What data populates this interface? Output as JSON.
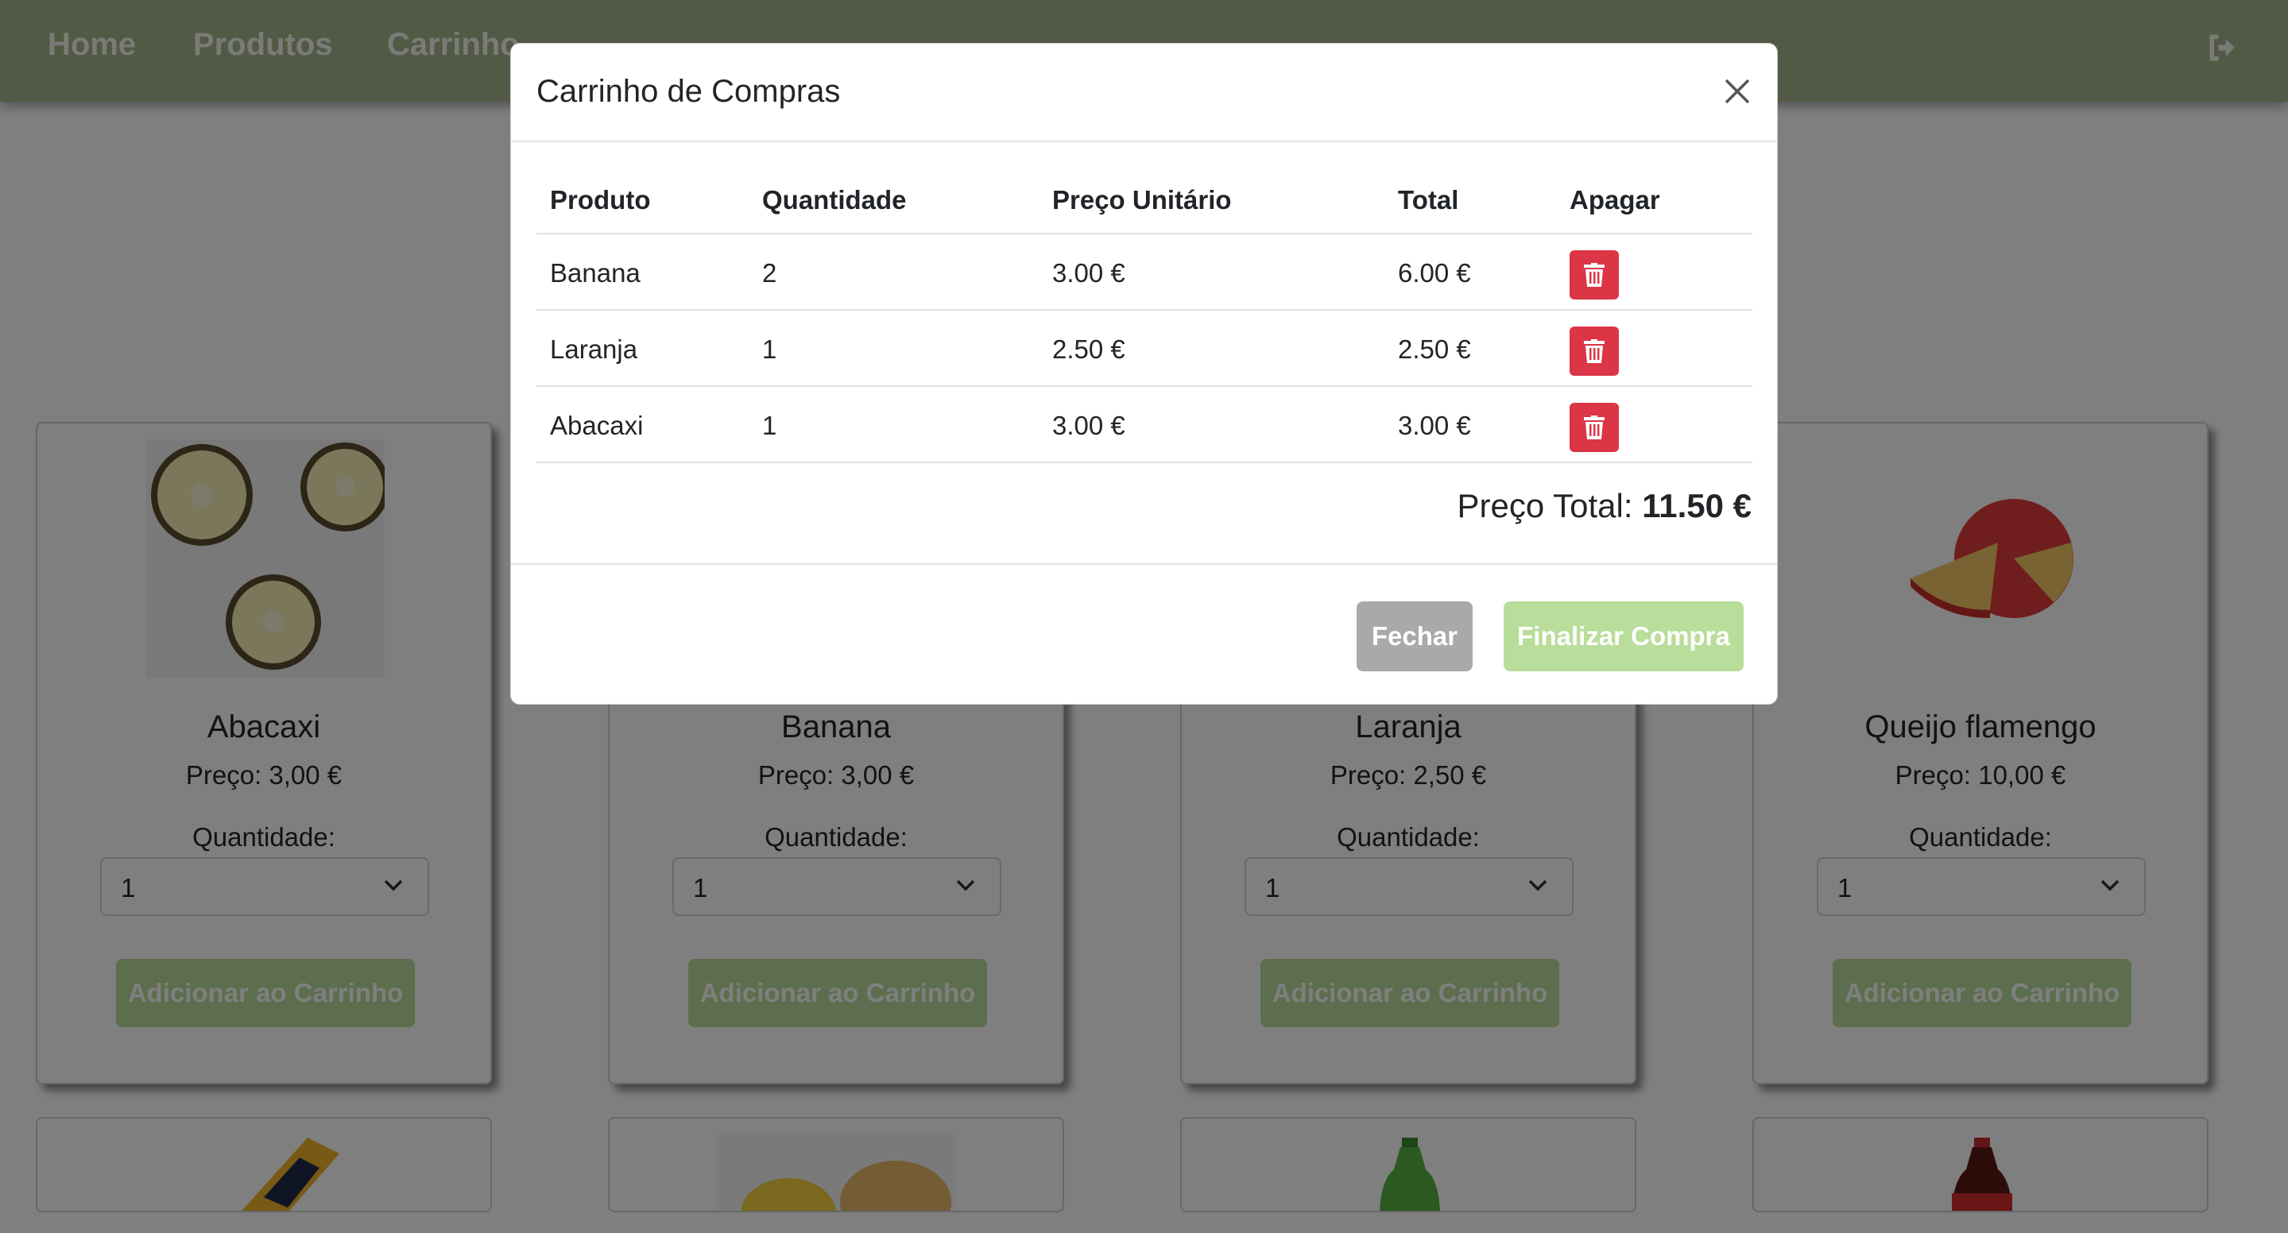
{
  "nav": {
    "home": "Home",
    "produtos": "Produtos",
    "carrinho": "Carrinho"
  },
  "products": [
    {
      "name": "Abacaxi",
      "price": "Preço: 3,00 €",
      "qty_label": "Quantidade:",
      "qty": "1",
      "add_label": "Adicionar ao Carrinho"
    },
    {
      "name": "Banana",
      "price": "Preço: 3,00 €",
      "qty_label": "Quantidade:",
      "qty": "1",
      "add_label": "Adicionar ao Carrinho"
    },
    {
      "name": "Laranja",
      "price": "Preço: 2,50 €",
      "qty_label": "Quantidade:",
      "qty": "1",
      "add_label": "Adicionar ao Carrinho"
    },
    {
      "name": "Queijo flamengo",
      "price": "Preço: 10,00 €",
      "qty_label": "Quantidade:",
      "qty": "1",
      "add_label": "Adicionar ao Carrinho"
    }
  ],
  "modal": {
    "title": "Carrinho de Compras",
    "headers": {
      "produto": "Produto",
      "quantidade": "Quantidade",
      "preco_unitario": "Preço Unitário",
      "total": "Total",
      "apagar": "Apagar"
    },
    "rows": [
      {
        "produto": "Banana",
        "quantidade": "2",
        "preco_unitario": "3.00 €",
        "total": "6.00 €"
      },
      {
        "produto": "Laranja",
        "quantidade": "1",
        "preco_unitario": "2.50 €",
        "total": "2.50 €"
      },
      {
        "produto": "Abacaxi",
        "quantidade": "1",
        "preco_unitario": "3.00 €",
        "total": "3.00 €"
      }
    ],
    "total_label": "Preço Total:",
    "total_value": "11.50 €",
    "close_label": "Fechar",
    "finish_label": "Finalizar Compra"
  },
  "colors": {
    "navbar": "#a4b58b",
    "primary_button": "#b9dd9a",
    "secondary_button": "#a9a9a9",
    "danger": "#dc3545"
  },
  "icons": {
    "logout": "logout-icon",
    "close": "close-icon",
    "delete": "trash-icon",
    "select": "chevron-down-icon"
  }
}
